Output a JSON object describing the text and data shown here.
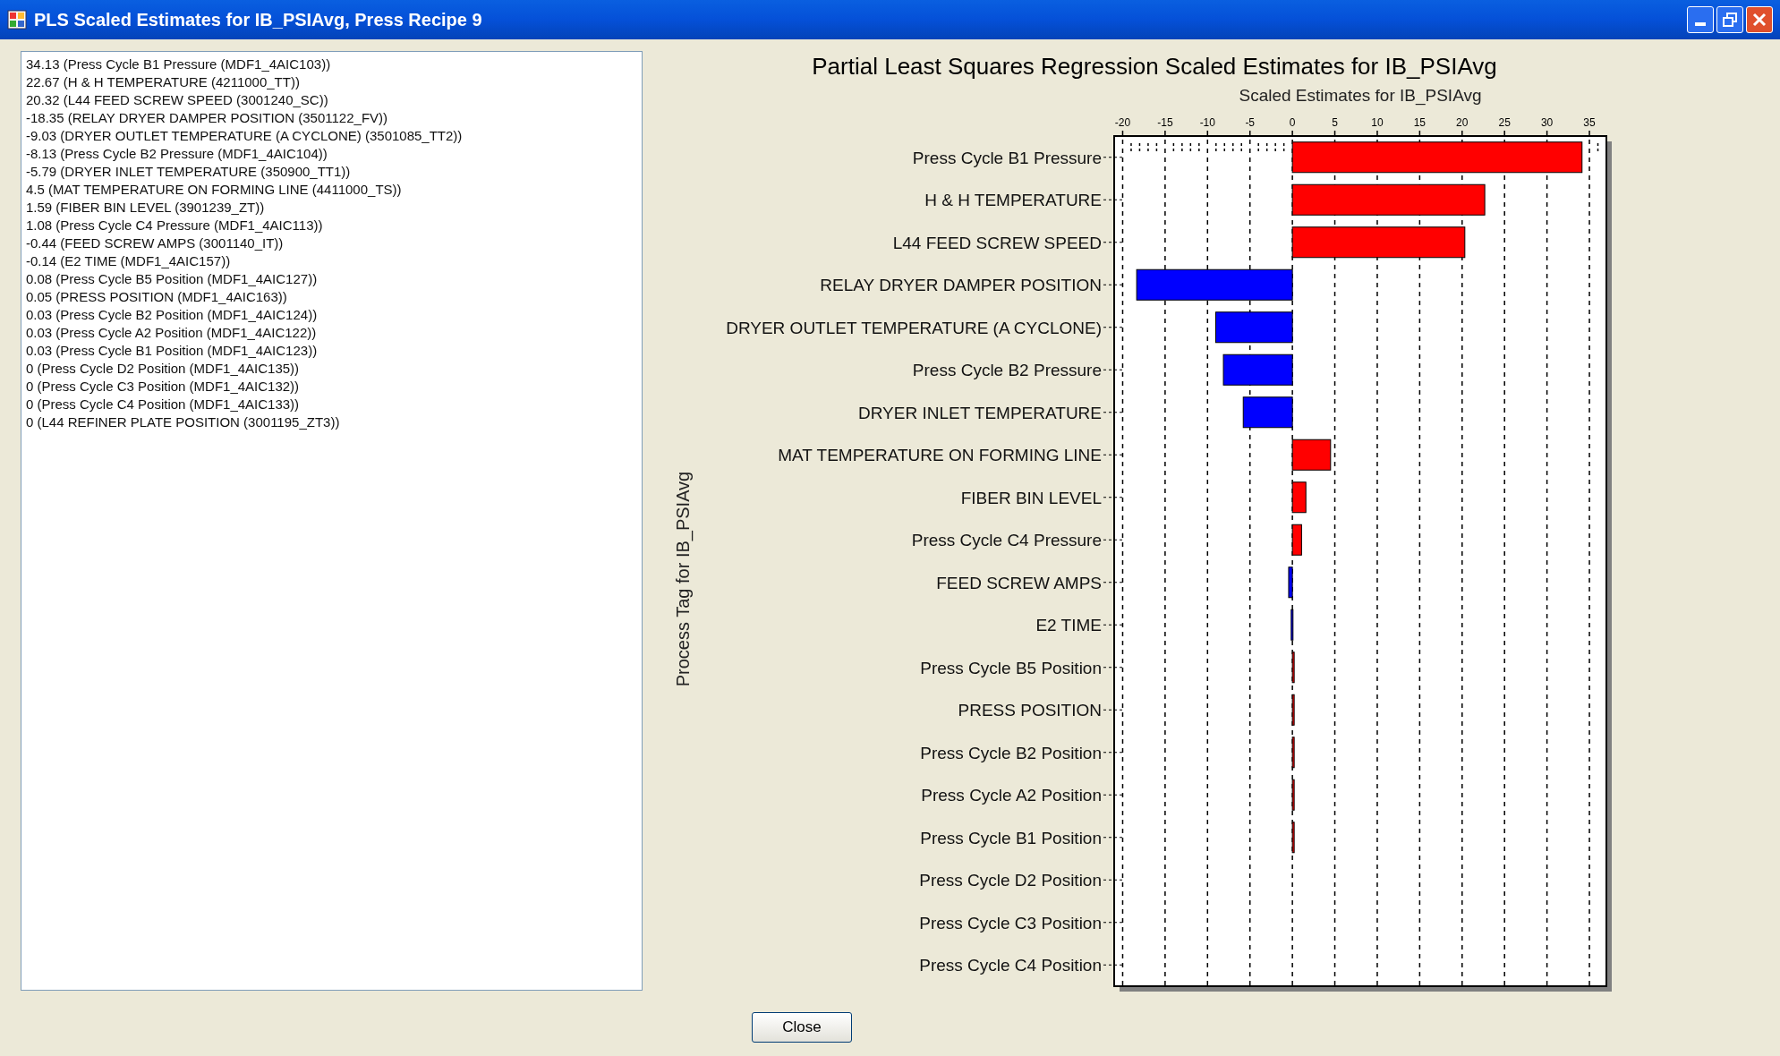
{
  "window": {
    "title": "PLS Scaled Estimates for IB_PSIAvg, Press Recipe 9"
  },
  "estimates_list": {
    "items": [
      "34.13 (Press Cycle B1 Pressure (MDF1_4AIC103))",
      "22.67 (H & H TEMPERATURE (4211000_TT))",
      "20.32 (L44 FEED SCREW SPEED (3001240_SC))",
      "-18.35 (RELAY DRYER DAMPER POSITION (3501122_FV))",
      "-9.03 (DRYER OUTLET TEMPERATURE (A CYCLONE) (3501085_TT2))",
      "-8.13 (Press Cycle B2 Pressure (MDF1_4AIC104))",
      "-5.79 (DRYER INLET TEMPERATURE (350900_TT1))",
      "4.5 (MAT TEMPERATURE ON FORMING LINE (4411000_TS))",
      "1.59 (FIBER BIN LEVEL (3901239_ZT))",
      "1.08 (Press Cycle C4 Pressure (MDF1_4AIC113))",
      "-0.44 (FEED SCREW AMPS (3001140_IT))",
      "-0.14 (E2 TIME (MDF1_4AIC157))",
      "0.08 (Press Cycle B5 Position (MDF1_4AIC127))",
      "0.05 (PRESS POSITION (MDF1_4AIC163))",
      "0.03 (Press Cycle B2 Position (MDF1_4AIC124))",
      "0.03 (Press Cycle A2 Position (MDF1_4AIC122))",
      "0.03 (Press Cycle B1 Position (MDF1_4AIC123))",
      "0 (Press Cycle D2 Position (MDF1_4AIC135))",
      "0 (Press Cycle C3 Position (MDF1_4AIC132))",
      "0 (Press Cycle C4 Position (MDF1_4AIC133))",
      "0 (L44 REFINER PLATE POSITION (3001195_ZT3))"
    ]
  },
  "chart": {
    "chart_data": {
      "type": "bar",
      "orientation": "horizontal",
      "title": "Partial Least Squares Regression Scaled Estimates for IB_PSIAvg",
      "xlabel": "Scaled Estimates for IB_PSIAvg",
      "ylabel": "Process Tag for IB_PSIAvg",
      "categories": [
        "Press Cycle B1 Pressure",
        "H & H TEMPERATURE",
        "L44 FEED SCREW SPEED",
        "RELAY DRYER DAMPER POSITION",
        "DRYER OUTLET TEMPERATURE (A CYCLONE)",
        "Press Cycle B2 Pressure",
        "DRYER INLET TEMPERATURE",
        "MAT TEMPERATURE ON FORMING LINE",
        "FIBER BIN LEVEL",
        "Press Cycle C4 Pressure",
        "FEED SCREW AMPS",
        "E2 TIME",
        "Press Cycle B5 Position",
        "PRESS POSITION",
        "Press Cycle B2 Position",
        "Press Cycle A2 Position",
        "Press Cycle B1 Position",
        "Press Cycle D2 Position",
        "Press Cycle C3 Position",
        "Press Cycle C4 Position"
      ],
      "values": [
        34.13,
        22.67,
        20.32,
        -18.35,
        -9.03,
        -8.13,
        -5.79,
        4.5,
        1.59,
        1.08,
        -0.44,
        -0.14,
        0.08,
        0.05,
        0.03,
        0.03,
        0.03,
        0,
        0,
        0
      ],
      "grid": true,
      "xlim": [
        -21,
        37
      ],
      "xticks": [
        -20,
        -15,
        -10,
        -5,
        0,
        5,
        10,
        15,
        20,
        25,
        30,
        35
      ]
    }
  },
  "buttons": [
    {
      "label": "Close"
    }
  ]
}
